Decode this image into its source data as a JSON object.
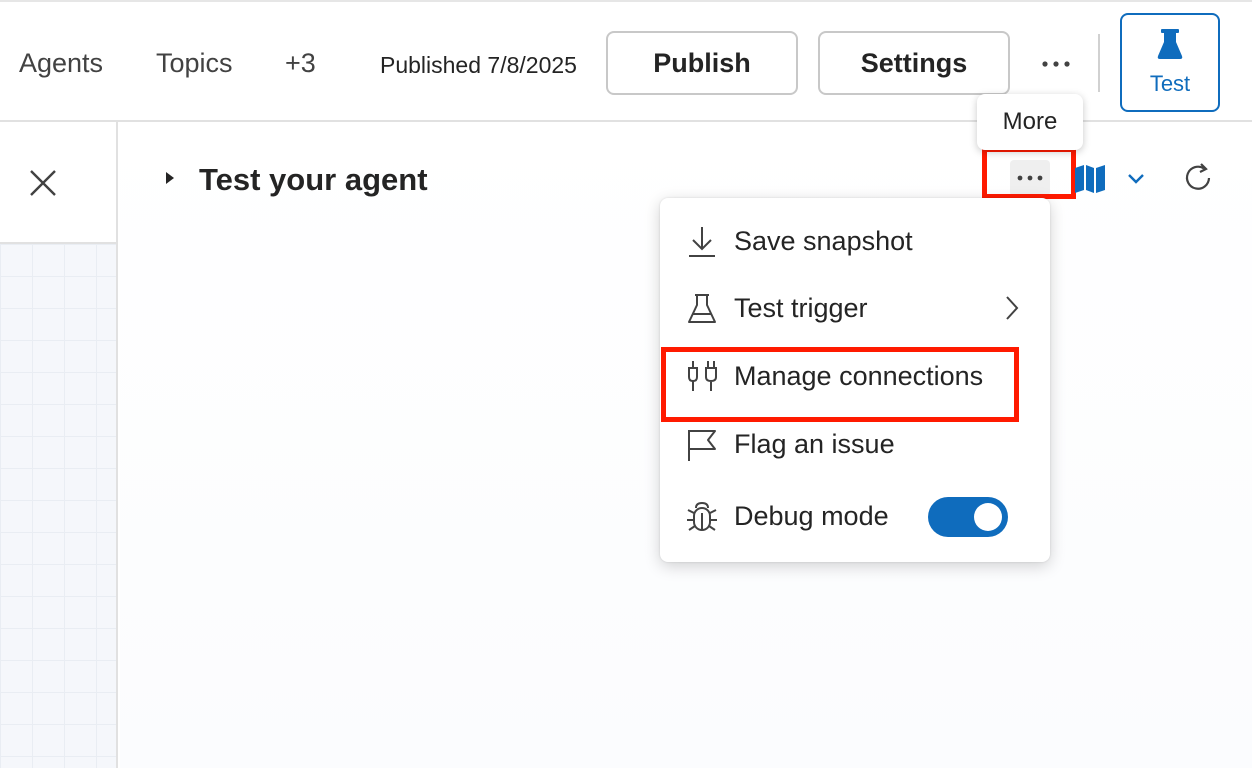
{
  "topbar": {
    "nav": [
      "Agents",
      "Topics",
      "+3"
    ],
    "published_label": "Published 7/8/2025",
    "publish_label": "Publish",
    "settings_label": "Settings",
    "more_icon": "more-horizontal-icon",
    "test_label": "Test",
    "test_icon": "flask-icon"
  },
  "left_panel": {
    "close_icon": "close-icon"
  },
  "test_pane": {
    "title": "Test your agent",
    "icons": [
      "more-horizontal-icon",
      "map-icon",
      "chevron-down-icon",
      "refresh-icon"
    ]
  },
  "tooltip": {
    "text": "More"
  },
  "menu": {
    "items": [
      {
        "label": "Save snapshot",
        "icon": "download-icon"
      },
      {
        "label": "Test trigger",
        "icon": "beaker-icon",
        "has_submenu": true
      },
      {
        "label": "Manage connections",
        "icon": "plug-connected-icon"
      },
      {
        "label": "Flag an issue",
        "icon": "flag-icon"
      },
      {
        "label": "Debug mode",
        "icon": "bug-icon",
        "toggle_on": true
      }
    ]
  },
  "colors": {
    "accent": "#0f6cbd",
    "highlight": "#ff1a00",
    "text": "#242424"
  }
}
